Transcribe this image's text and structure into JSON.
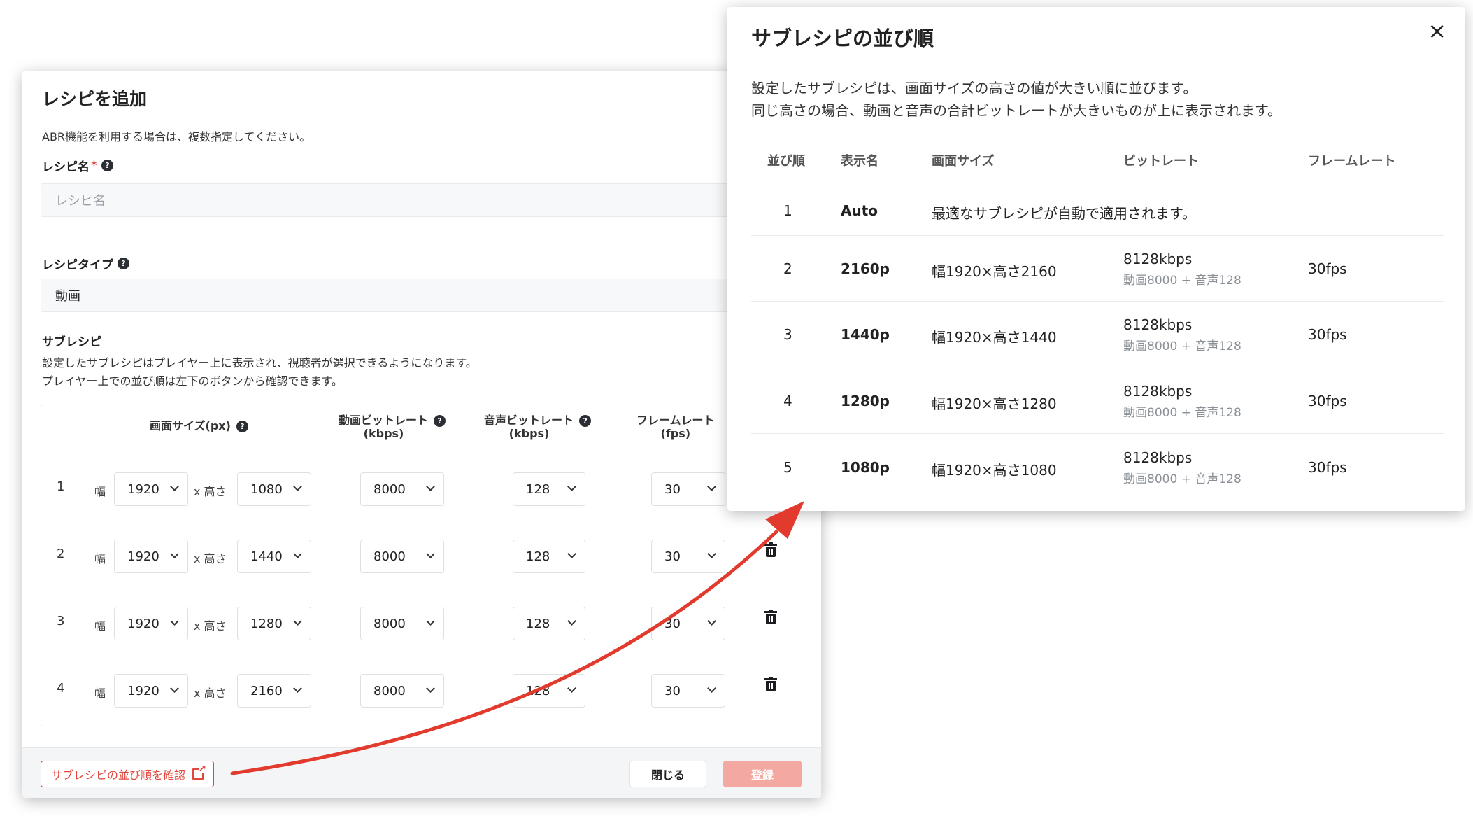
{
  "add_recipe": {
    "title": "レシピを追加",
    "description": "ABR機能を利用する場合は、複数指定してください。",
    "recipe_name_label": "レシピ名",
    "required_mark": "*",
    "recipe_name_placeholder": "レシピ名",
    "recipe_type_label": "レシピタイプ",
    "recipe_type_value": "動画",
    "subrecipe_label": "サブレシピ",
    "subrecipe_desc_1": "設定したサブレシピはプレイヤー上に表示され、視聴者が選択できるようになります。",
    "subrecipe_desc_2": "プレイヤー上での並び順は左下のボタンから確認できます。",
    "headers": {
      "screen_size": "画面サイズ(px)",
      "video_bitrate_1": "動画ビットレート",
      "video_bitrate_2": "(kbps)",
      "audio_bitrate_1": "音声ビットレート",
      "audio_bitrate_2": "(kbps)",
      "framerate_1": "フレームレート",
      "framerate_2": "(fps)"
    },
    "width_label": "幅",
    "height_label": "x 高さ",
    "rows": [
      {
        "num": "1",
        "width": "1920",
        "height": "1080",
        "video": "8000",
        "audio": "128",
        "fps": "30",
        "deletable": false
      },
      {
        "num": "2",
        "width": "1920",
        "height": "1440",
        "video": "8000",
        "audio": "128",
        "fps": "30",
        "deletable": true
      },
      {
        "num": "3",
        "width": "1920",
        "height": "1280",
        "video": "8000",
        "audio": "128",
        "fps": "30",
        "deletable": true
      },
      {
        "num": "4",
        "width": "1920",
        "height": "2160",
        "video": "8000",
        "audio": "128",
        "fps": "30",
        "deletable": true
      }
    ],
    "footer": {
      "order_button": "サブレシピの並び順を確認",
      "close_button": "閉じる",
      "register_button": "登録"
    }
  },
  "subrecipe_order": {
    "title": "サブレシピの並び順",
    "close": "×",
    "desc_1": "設定したサブレシピは、画面サイズの高さの値が大きい順に並びます。",
    "desc_2": "同じ高さの場合、動画と音声の合計ビットレートが大きいものが上に表示されます。",
    "headers": {
      "order": "並び順",
      "display_name": "表示名",
      "screen_size": "画面サイズ",
      "bitrate": "ビットレート",
      "framerate": "フレームレート"
    },
    "auto_row": {
      "order": "1",
      "name": "Auto",
      "note": "最適なサブレシピが自動で適用されます。"
    },
    "rows": [
      {
        "order": "2",
        "name": "2160p",
        "size": "幅1920×高さ2160",
        "bitrate": "8128kbps",
        "breakdown": "動画8000 + 音声128",
        "fps": "30fps"
      },
      {
        "order": "3",
        "name": "1440p",
        "size": "幅1920×高さ1440",
        "bitrate": "8128kbps",
        "breakdown": "動画8000 + 音声128",
        "fps": "30fps"
      },
      {
        "order": "4",
        "name": "1280p",
        "size": "幅1920×高さ1280",
        "bitrate": "8128kbps",
        "breakdown": "動画8000 + 音声128",
        "fps": "30fps"
      },
      {
        "order": "5",
        "name": "1080p",
        "size": "幅1920×高さ1080",
        "bitrate": "8128kbps",
        "breakdown": "動画8000 + 音声128",
        "fps": "30fps"
      }
    ]
  },
  "colors": {
    "accent": "#e0463b",
    "register_disabled": "#f4a8a2",
    "arrow": "#e23a2c"
  }
}
